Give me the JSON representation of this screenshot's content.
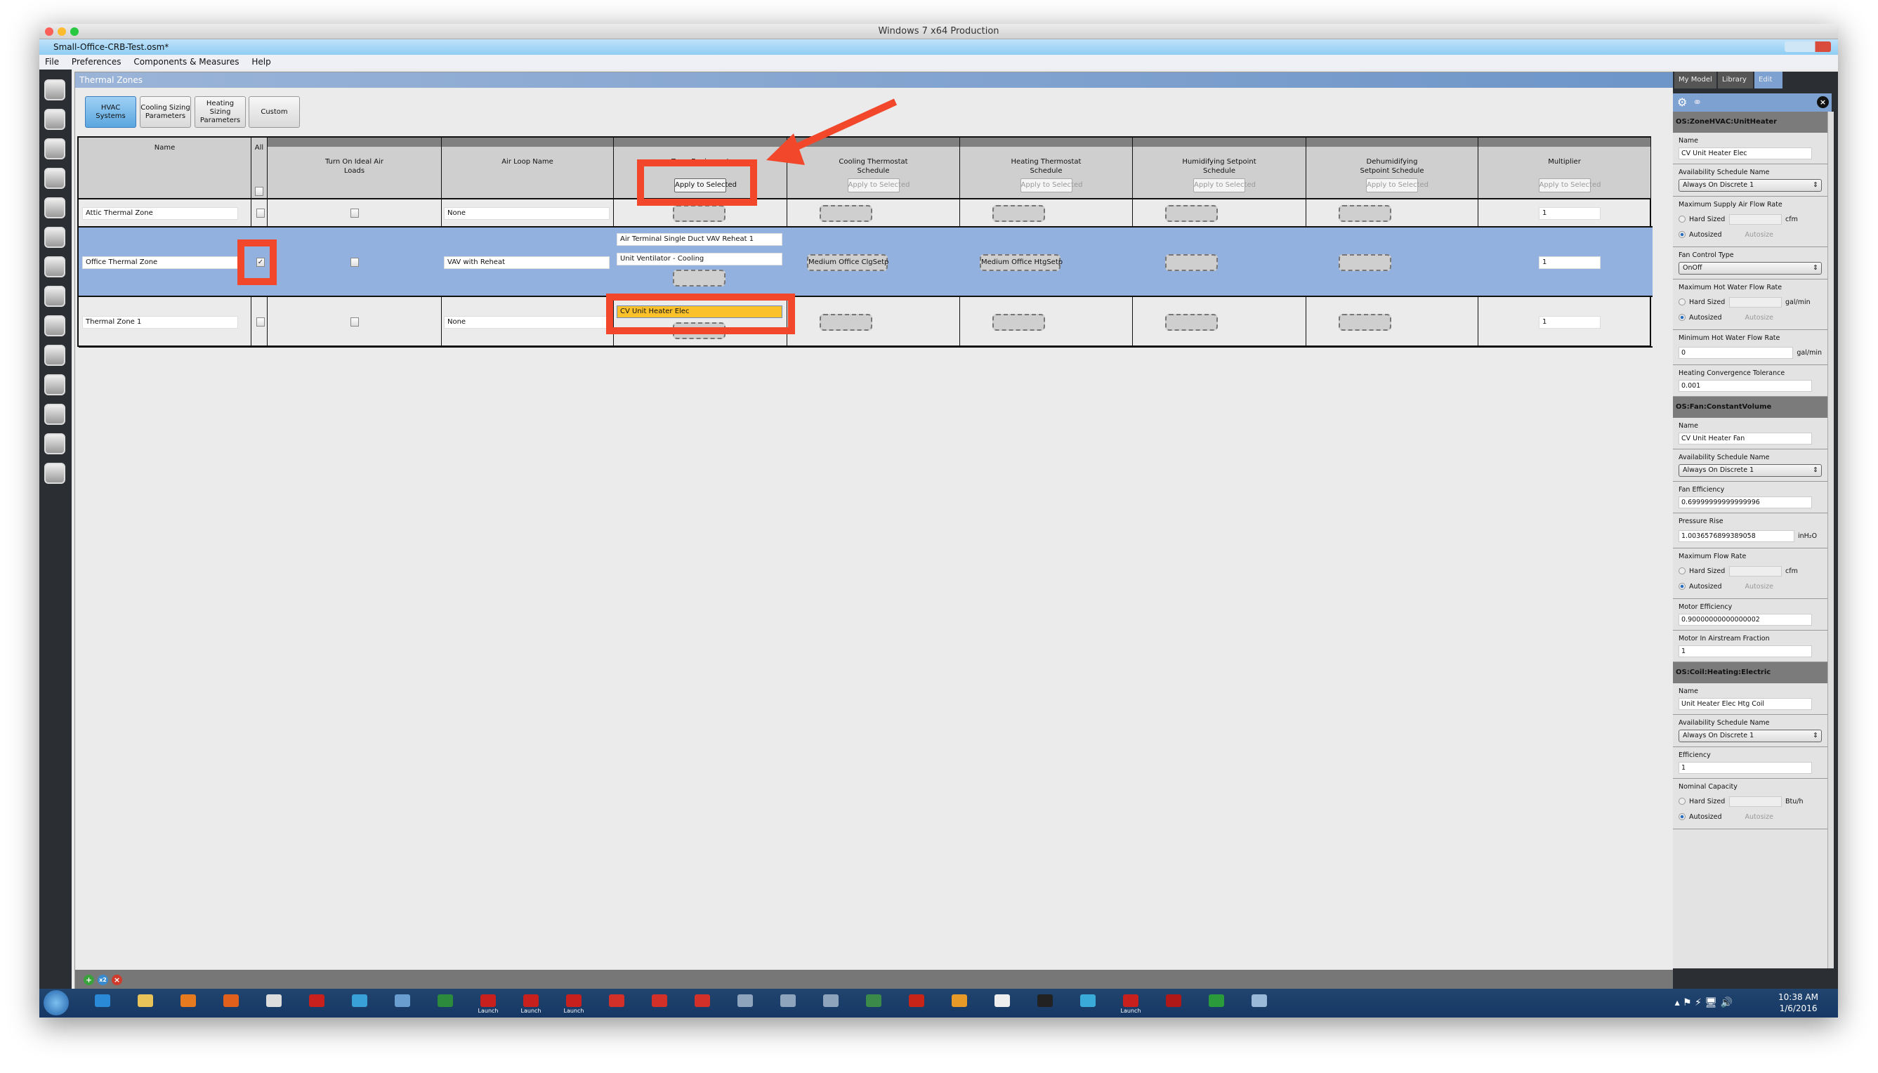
{
  "mac_title": "Windows 7 x64 Production",
  "app_title": "Small-Office-CRB-Test.osm*",
  "menu": [
    "File",
    "Preferences",
    "Components & Measures",
    "Help"
  ],
  "main": {
    "header": "Thermal Zones",
    "subtabs": [
      {
        "label": "HVAC Systems",
        "active": true
      },
      {
        "label": "Cooling Sizing Parameters",
        "active": false
      },
      {
        "label": "Heating Sizing Parameters",
        "active": false
      },
      {
        "label": "Custom",
        "active": false
      }
    ],
    "columns": [
      "Name",
      "All",
      "Turn On Ideal Air Loads",
      "Air Loop Name",
      "Zone Equipment",
      "Cooling Thermostat Schedule",
      "Heating Thermostat Schedule",
      "Humidifying Setpoint Schedule",
      "Dehumidifying Setpoint Schedule",
      "Multiplier"
    ],
    "apply_label": "Apply to Selected",
    "rows": [
      {
        "name": "Attic Thermal Zone",
        "selected": false,
        "ideal": false,
        "air_loop": "None",
        "equipment": [],
        "cooling": "",
        "heating": "",
        "multiplier": "1"
      },
      {
        "name": "Office Thermal Zone",
        "selected": true,
        "ideal": false,
        "air_loop": "VAV with Reheat",
        "equipment": [
          "Air Terminal Single Duct VAV Reheat 1",
          "Unit Ventilator - Cooling"
        ],
        "cooling": "Medium Office ClgSetp",
        "heating": "Medium Office HtgSetp",
        "multiplier": "1"
      },
      {
        "name": "Thermal Zone 1",
        "selected": false,
        "ideal": false,
        "air_loop": "None",
        "equipment": [
          "CV Unit Heater Elec"
        ],
        "cooling": "",
        "heating": "",
        "multiplier": "1"
      }
    ],
    "checkmark": "✓"
  },
  "right_panel": {
    "tabs": [
      "My Model",
      "Library",
      "Edit"
    ],
    "active_tab": "Edit",
    "sections": [
      {
        "title": "OS:ZoneHVAC:UnitHeater",
        "fields": [
          {
            "type": "text",
            "label": "Name",
            "value": "CV Unit Heater Elec"
          },
          {
            "type": "select",
            "label": "Availability Schedule Name",
            "value": "Always On Discrete 1"
          },
          {
            "type": "autosize",
            "label": "Maximum Supply Air Flow Rate",
            "unit": "cfm",
            "hard": "Hard Sized",
            "auto": "Autosized",
            "ghost": "Autosize"
          },
          {
            "type": "select",
            "label": "Fan Control Type",
            "value": "OnOff"
          },
          {
            "type": "autosize",
            "label": "Maximum Hot Water Flow Rate",
            "unit": "gal/min",
            "hard": "Hard Sized",
            "auto": "Autosized",
            "ghost": "Autosize"
          },
          {
            "type": "textunit",
            "label": "Minimum Hot Water Flow Rate",
            "value": "0",
            "unit": "gal/min"
          },
          {
            "type": "text",
            "label": "Heating Convergence Tolerance",
            "value": "0.001"
          }
        ]
      },
      {
        "title": "OS:Fan:ConstantVolume",
        "fields": [
          {
            "type": "text",
            "label": "Name",
            "value": "CV Unit Heater Fan"
          },
          {
            "type": "select",
            "label": "Availability Schedule Name",
            "value": "Always On Discrete 1"
          },
          {
            "type": "text",
            "label": "Fan Efficiency",
            "value": "0.69999999999999996"
          },
          {
            "type": "textunit",
            "label": "Pressure Rise",
            "value": "1.0036576899389058",
            "unit": "inH₂O"
          },
          {
            "type": "autosize",
            "label": "Maximum Flow Rate",
            "unit": "cfm",
            "hard": "Hard Sized",
            "auto": "Autosized",
            "ghost": "Autosize"
          },
          {
            "type": "text",
            "label": "Motor Efficiency",
            "value": "0.90000000000000002"
          },
          {
            "type": "text",
            "label": "Motor In Airstream Fraction",
            "value": "1"
          }
        ]
      },
      {
        "title": "OS:Coil:Heating:Electric",
        "fields": [
          {
            "type": "text",
            "label": "Name",
            "value": "Unit Heater Elec Htg Coil"
          },
          {
            "type": "select",
            "label": "Availability Schedule Name",
            "value": "Always On Discrete 1"
          },
          {
            "type": "text",
            "label": "Efficiency",
            "value": "1"
          },
          {
            "type": "autosize",
            "label": "Nominal Capacity",
            "unit": "Btu/h",
            "hard": "Hard Sized",
            "auto": "Autosized",
            "ghost": "Autosize"
          }
        ]
      }
    ]
  },
  "taskbar": {
    "apps": [
      {
        "icon": "ie-icon",
        "color": "#2a8ad8"
      },
      {
        "icon": "explorer-icon",
        "color": "#e8c35a"
      },
      {
        "icon": "media-player-icon",
        "color": "#e57a1e"
      },
      {
        "icon": "firefox-icon",
        "color": "#e0601c"
      },
      {
        "icon": "transfer-icon",
        "color": "#ddd"
      },
      {
        "icon": "acrobat-icon",
        "color": "#c8201c"
      },
      {
        "icon": "app-icon",
        "color": "#3aa0d8"
      },
      {
        "icon": "tool-icon",
        "color": "#6a9ed0"
      },
      {
        "icon": "play-icon",
        "color": "#2c8a3c"
      },
      {
        "icon": "launch-icon",
        "color": "#c8201c",
        "label": "Launch"
      },
      {
        "icon": "launch-icon",
        "color": "#c8201c",
        "label": "Launch"
      },
      {
        "icon": "launch-icon",
        "color": "#c8201c",
        "label": "Launch"
      },
      {
        "icon": "sketchup-icon",
        "color": "#d4302a"
      },
      {
        "icon": "sketchup-icon",
        "color": "#d4302a"
      },
      {
        "icon": "sketchup-icon",
        "color": "#d4302a"
      },
      {
        "icon": "openstudio-icon",
        "color": "#8ea4bd"
      },
      {
        "icon": "openstudio-icon",
        "color": "#8ea4bd"
      },
      {
        "icon": "openstudio-icon",
        "color": "#8ea4bd"
      },
      {
        "icon": "monitor-icon",
        "color": "#3b8a4a"
      },
      {
        "icon": "record-icon",
        "color": "#c82418"
      },
      {
        "icon": "box-icon",
        "color": "#e89a28"
      },
      {
        "icon": "document-icon",
        "color": "#eee"
      },
      {
        "icon": "terminal-icon",
        "color": "#222"
      },
      {
        "icon": "globe-icon",
        "color": "#3aaad8"
      },
      {
        "icon": "launch-icon",
        "color": "#c8201c",
        "label": "Launch"
      },
      {
        "icon": "ruby-icon",
        "color": "#b01818"
      },
      {
        "icon": "spreadsheet-icon",
        "color": "#2a9a3a"
      },
      {
        "icon": "pdf-icon",
        "color": "#9ab8d8"
      }
    ],
    "time": "10:38 AM",
    "date": "1/6/2016"
  },
  "annotation_color": "#f2472b"
}
